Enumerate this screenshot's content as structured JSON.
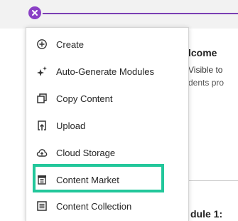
{
  "background": {
    "section_title": "lcome",
    "visible_text": "Visible to",
    "students_text": "dents pro",
    "module_heading": "dule 1:"
  },
  "menu": {
    "items": [
      {
        "label": "Create",
        "icon": "plus-circle-icon"
      },
      {
        "label": "Auto-Generate Modules",
        "icon": "sparkle-icon"
      },
      {
        "label": "Copy Content",
        "icon": "copy-icon"
      },
      {
        "label": "Upload",
        "icon": "upload-icon"
      },
      {
        "label": "Cloud Storage",
        "icon": "cloud-icon"
      },
      {
        "label": "Content Market",
        "icon": "store-icon"
      },
      {
        "label": "Content Collection",
        "icon": "collection-icon"
      }
    ],
    "highlighted_item": "Content Market"
  },
  "colors": {
    "accent": "#8a3fc5",
    "highlight": "#22c79b"
  }
}
